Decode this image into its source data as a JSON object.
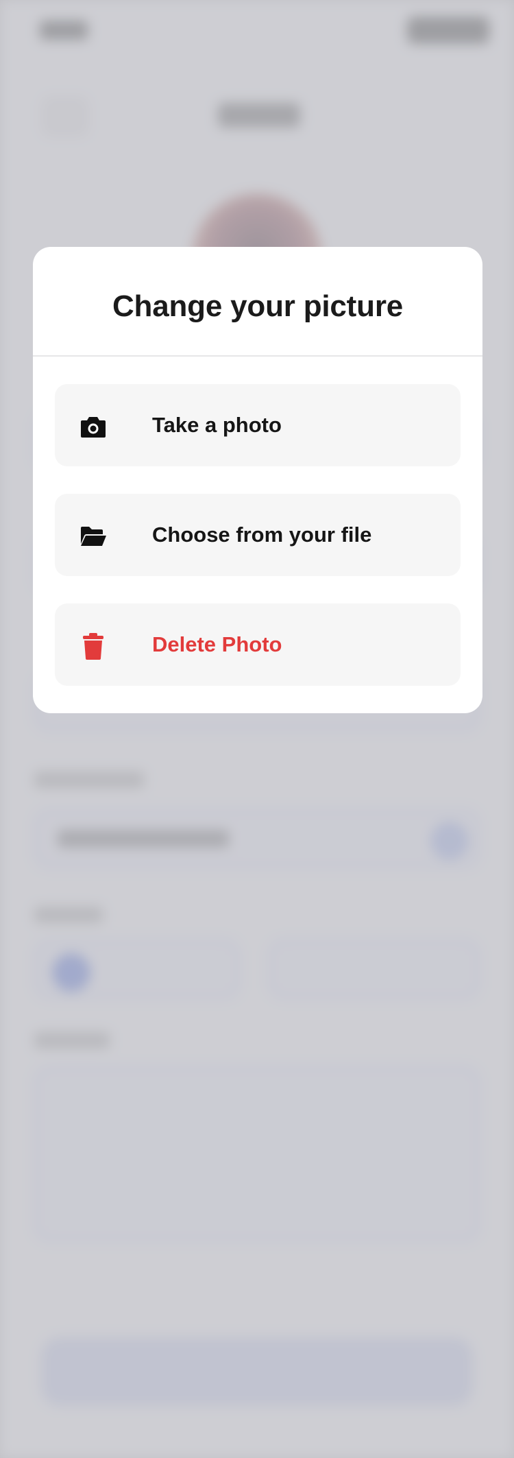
{
  "modal": {
    "title": "Change your picture",
    "options": [
      {
        "label": "Take a photo",
        "icon": "camera-icon"
      },
      {
        "label": "Choose from your file",
        "icon": "folder-open-icon"
      },
      {
        "label": "Delete Photo",
        "icon": "trash-icon"
      }
    ]
  },
  "colors": {
    "danger": "#e23b3b",
    "text_dark": "#161616",
    "option_bg": "#f6f6f6",
    "accent_blurred": "#5a78e0"
  }
}
